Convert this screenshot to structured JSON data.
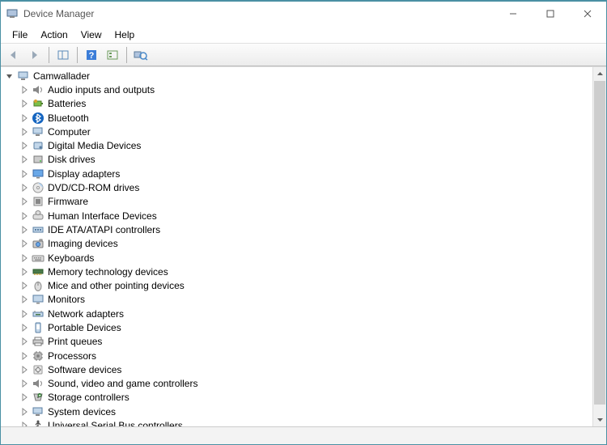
{
  "window": {
    "title": "Device Manager"
  },
  "menu": {
    "items": [
      "File",
      "Action",
      "View",
      "Help"
    ]
  },
  "toolbar": {
    "buttons": [
      {
        "name": "back",
        "icon": "arrow-left"
      },
      {
        "name": "forward",
        "icon": "arrow-right"
      },
      {
        "name": "properties",
        "icon": "grid"
      },
      {
        "name": "help",
        "icon": "help"
      },
      {
        "name": "update-driver",
        "icon": "update"
      },
      {
        "name": "uninstall",
        "icon": "scan"
      }
    ]
  },
  "tree": {
    "root": {
      "label": "Camwallader",
      "expanded": true,
      "icon": "computer"
    },
    "children": [
      {
        "label": "Audio inputs and outputs",
        "icon": "audio"
      },
      {
        "label": "Batteries",
        "icon": "battery"
      },
      {
        "label": "Bluetooth",
        "icon": "bluetooth"
      },
      {
        "label": "Computer",
        "icon": "computer"
      },
      {
        "label": "Digital Media Devices",
        "icon": "media"
      },
      {
        "label": "Disk drives",
        "icon": "disk"
      },
      {
        "label": "Display adapters",
        "icon": "display"
      },
      {
        "label": "DVD/CD-ROM drives",
        "icon": "cd"
      },
      {
        "label": "Firmware",
        "icon": "firmware"
      },
      {
        "label": "Human Interface Devices",
        "icon": "hid"
      },
      {
        "label": "IDE ATA/ATAPI controllers",
        "icon": "ide"
      },
      {
        "label": "Imaging devices",
        "icon": "imaging"
      },
      {
        "label": "Keyboards",
        "icon": "keyboard"
      },
      {
        "label": "Memory technology devices",
        "icon": "memory"
      },
      {
        "label": "Mice and other pointing devices",
        "icon": "mouse"
      },
      {
        "label": "Monitors",
        "icon": "monitor"
      },
      {
        "label": "Network adapters",
        "icon": "network"
      },
      {
        "label": "Portable Devices",
        "icon": "portable"
      },
      {
        "label": "Print queues",
        "icon": "print"
      },
      {
        "label": "Processors",
        "icon": "cpu"
      },
      {
        "label": "Software devices",
        "icon": "software"
      },
      {
        "label": "Sound, video and game controllers",
        "icon": "sound"
      },
      {
        "label": "Storage controllers",
        "icon": "storage"
      },
      {
        "label": "System devices",
        "icon": "system"
      },
      {
        "label": "Universal Serial Bus controllers",
        "icon": "usb"
      }
    ]
  }
}
